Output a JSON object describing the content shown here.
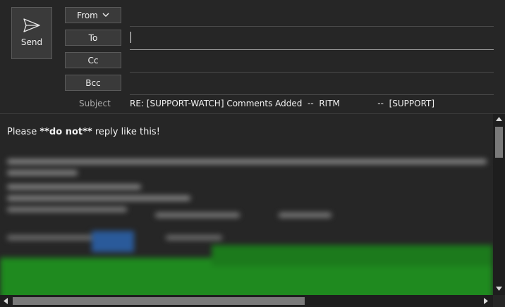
{
  "header": {
    "send_label": "Send",
    "from_label": "From",
    "to_label": "To",
    "cc_label": "Cc",
    "bcc_label": "Bcc",
    "subject_label": "Subject",
    "subject_value": "RE: [SUPPORT-WATCH] Comments Added  --  RITM              --  [SUPPORT]"
  },
  "body": {
    "prefix": "Please ",
    "bold": "**do not**",
    "suffix": " reply like this!"
  },
  "icons": {
    "send": "paper-plane-icon",
    "from_dropdown": "chevron-down-icon"
  },
  "colors": {
    "background": "#262626",
    "button": "#3a3a3a",
    "text": "#f0f0f0",
    "blurred_green": "#1f8a1f"
  }
}
